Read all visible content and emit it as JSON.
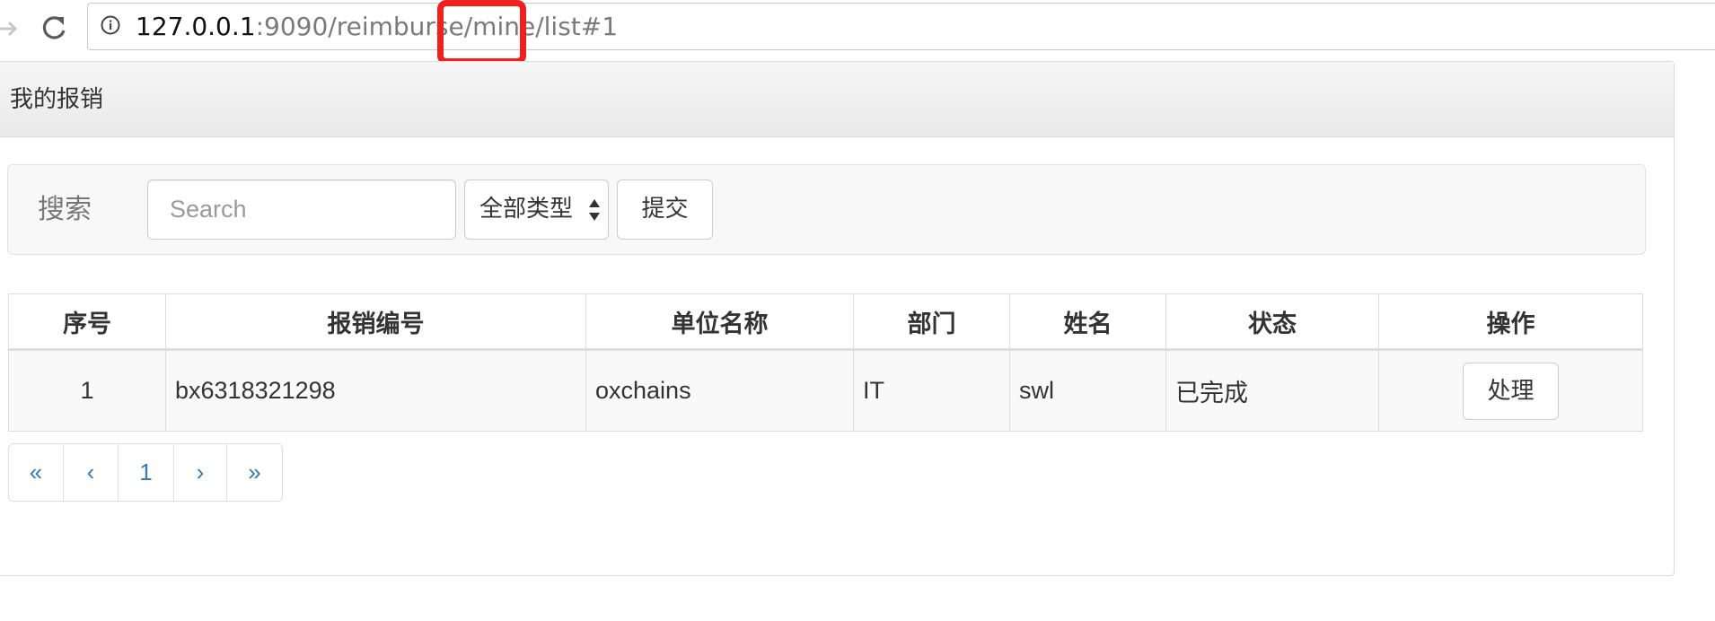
{
  "browser": {
    "url_host": "127.0.0.1",
    "url_path": ":9090/reimburse/mine/list#1",
    "highlight_color": "#f0201f"
  },
  "panel": {
    "title": "我的报销"
  },
  "search": {
    "label": "搜索",
    "placeholder": "Search",
    "type_selected": "全部类型",
    "submit_label": "提交"
  },
  "table": {
    "headers": [
      "序号",
      "报销编号",
      "单位名称",
      "部门",
      "姓名",
      "状态",
      "操作"
    ],
    "rows": [
      {
        "index": "1",
        "number": "bx6318321298",
        "company": "oxchains",
        "department": "IT",
        "name": "swl",
        "status": "已完成",
        "action": "处理"
      }
    ]
  },
  "pagination": {
    "first": "«",
    "prev": "‹",
    "current": "1",
    "next": "›",
    "last": "»",
    "link_color": "#337ab7"
  }
}
